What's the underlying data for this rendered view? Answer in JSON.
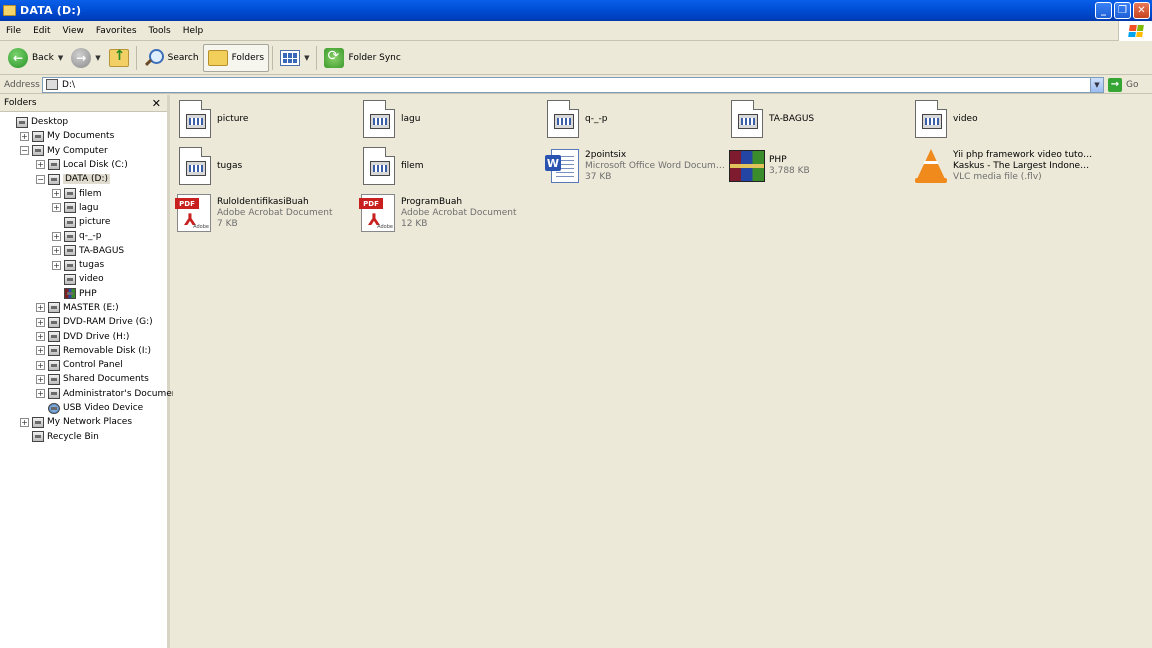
{
  "window": {
    "title": "DATA  (D:)"
  },
  "menu": [
    "File",
    "Edit",
    "View",
    "Favorites",
    "Tools",
    "Help"
  ],
  "toolbar": {
    "back_label": "Back",
    "search_label": "Search",
    "folders_label": "Folders",
    "folder_sync_label": "Folder Sync"
  },
  "address": {
    "label": "Address",
    "value": "D:\\",
    "go_label": "Go"
  },
  "folders_pane": {
    "title": "Folders",
    "close_glyph": "✕",
    "tree": [
      {
        "label": "Desktop",
        "level": 0,
        "expander": "none",
        "icon": "desktop"
      },
      {
        "label": "My Documents",
        "level": 1,
        "expander": "+",
        "icon": "folder"
      },
      {
        "label": "My Computer",
        "level": 1,
        "expander": "-",
        "icon": "computer"
      },
      {
        "label": "Local Disk (C:)",
        "level": 2,
        "expander": "+",
        "icon": "drive"
      },
      {
        "label": "DATA  (D:)",
        "level": 2,
        "expander": "-",
        "icon": "drive",
        "selected": true
      },
      {
        "label": "filem",
        "level": 3,
        "expander": "+",
        "icon": "folder"
      },
      {
        "label": "lagu",
        "level": 3,
        "expander": "+",
        "icon": "folder"
      },
      {
        "label": "picture",
        "level": 3,
        "expander": "none",
        "icon": "folder"
      },
      {
        "label": "q-_-p",
        "level": 3,
        "expander": "+",
        "icon": "folder"
      },
      {
        "label": "TA-BAGUS",
        "level": 3,
        "expander": "+",
        "icon": "folder"
      },
      {
        "label": "tugas",
        "level": 3,
        "expander": "+",
        "icon": "folder"
      },
      {
        "label": "video",
        "level": 3,
        "expander": "none",
        "icon": "folder"
      },
      {
        "label": "PHP",
        "level": 3,
        "expander": "none",
        "icon": "rar"
      },
      {
        "label": "MASTER (E:)",
        "level": 2,
        "expander": "+",
        "icon": "drive"
      },
      {
        "label": "DVD-RAM Drive (G:)",
        "level": 2,
        "expander": "+",
        "icon": "drive"
      },
      {
        "label": "DVD Drive (H:)",
        "level": 2,
        "expander": "+",
        "icon": "drive"
      },
      {
        "label": "Removable Disk (I:)",
        "level": 2,
        "expander": "+",
        "icon": "drive"
      },
      {
        "label": "Control Panel",
        "level": 2,
        "expander": "+",
        "icon": "folder"
      },
      {
        "label": "Shared Documents",
        "level": 2,
        "expander": "+",
        "icon": "folder"
      },
      {
        "label": "Administrator's Documents",
        "level": 2,
        "expander": "+",
        "icon": "folder"
      },
      {
        "label": "USB Video Device",
        "level": 2,
        "expander": "none",
        "icon": "globe"
      },
      {
        "label": "My Network Places",
        "level": 1,
        "expander": "+",
        "icon": "network"
      },
      {
        "label": "Recycle Bin",
        "level": 1,
        "expander": "none",
        "icon": "recycle"
      }
    ]
  },
  "files": [
    {
      "name": "picture",
      "type": "folder",
      "lines": []
    },
    {
      "name": "lagu",
      "type": "folder",
      "lines": []
    },
    {
      "name": "q-_-p",
      "type": "folder",
      "lines": []
    },
    {
      "name": "TA-BAGUS",
      "type": "folder",
      "lines": []
    },
    {
      "name": "video",
      "type": "folder",
      "lines": []
    },
    {
      "name": "tugas",
      "type": "folder",
      "lines": []
    },
    {
      "name": "filem",
      "type": "folder",
      "lines": []
    },
    {
      "name": "2pointsix",
      "type": "word",
      "lines": [
        "Microsoft Office Word Document",
        "37 KB"
      ]
    },
    {
      "name": "PHP",
      "type": "rar",
      "lines": [
        "3,788 KB"
      ]
    },
    {
      "name": "Yii php framework video tutorial -",
      "type": "vlc",
      "lines": [
        "Kaskus - The Largest Indonesi...",
        "VLC media file (.flv)"
      ]
    },
    {
      "name": "RuloIdentifikasiBuah",
      "type": "pdf",
      "lines": [
        "Adobe Acrobat Document",
        "7 KB"
      ]
    },
    {
      "name": "ProgramBuah",
      "type": "pdf",
      "lines": [
        "Adobe Acrobat Document",
        "12 KB"
      ]
    }
  ]
}
